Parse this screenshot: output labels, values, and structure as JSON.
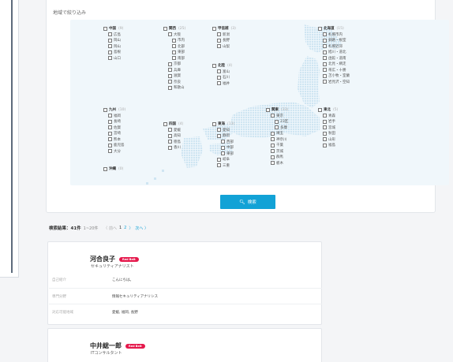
{
  "filter": {
    "title": "地域で絞り込み",
    "regions": [
      {
        "name": "中国",
        "count": "(9)",
        "prefs": [
          "広島",
          "岡山",
          "岡山",
          "島根",
          "山口"
        ]
      },
      {
        "name": "関西",
        "count": "(25)",
        "prefs": [
          "大阪",
          "市内",
          "北部",
          "東部",
          "南部",
          "京都",
          "兵庫",
          "滋賀",
          "奈良",
          "和歌山"
        ]
      },
      {
        "name": "甲信越",
        "count": "(3)",
        "prefs": [
          "新潟",
          "長野",
          "山梨"
        ]
      },
      {
        "name": "北陸",
        "count": "(4)",
        "prefs": [
          "富山",
          "石川",
          "福井"
        ]
      },
      {
        "name": "北海道",
        "count": "(15)",
        "prefs": [
          "札幌市内",
          "釧路・根室",
          "札幌近郊",
          "旭川・道北",
          "函館・道南",
          "北見・網走",
          "帯広・十勝",
          "苫小牧・室蘭",
          "岩見沢・空知"
        ]
      },
      {
        "name": "九州",
        "count": "(10)",
        "prefs": [
          "福岡",
          "長崎",
          "佐賀",
          "宮崎",
          "熊本",
          "鹿児島",
          "大分"
        ]
      },
      {
        "name": "四国",
        "count": "(4)",
        "prefs": [
          "愛媛",
          "高知",
          "徳島",
          "香川"
        ]
      },
      {
        "name": "東海",
        "count": "(13)",
        "prefs": [
          "愛知",
          "静岡",
          "西部",
          "中部",
          "東部",
          "岐阜",
          "三重"
        ]
      },
      {
        "name": "関東",
        "count": "(33)",
        "prefs": [
          "東京",
          "23区",
          "多摩",
          "埼玉",
          "神奈川",
          "千葉",
          "茨城",
          "群馬",
          "栃木"
        ]
      },
      {
        "name": "東北",
        "count": "(5)",
        "prefs": [
          "青森",
          "岩手",
          "宮城",
          "秋田",
          "山形",
          "福島"
        ]
      },
      {
        "name": "沖縄",
        "count": "(0)",
        "prefs": []
      }
    ],
    "search_label": "検索",
    "search_icon": "magnifier-icon"
  },
  "results": {
    "label": "検索結果：41件",
    "range": "1~20件",
    "prev": "〈 前へ",
    "pages": [
      "1",
      "2"
    ],
    "next_sep": "〉",
    "next": "次へ 〉"
  },
  "cards": [
    {
      "name": "河合良子",
      "badge": "Red Belt",
      "title": "セキュリティアナリスト",
      "rows": [
        {
          "key": "自己紹介",
          "value": "こんにちは。"
        },
        {
          "key": "専門分野",
          "value": "情報セキュリティアナリシス"
        },
        {
          "key": "対応可能地域",
          "value": "愛媛, 福岡, 長野"
        }
      ]
    },
    {
      "name": "中井総一郎",
      "badge": "Red Belt",
      "title": "ITコンサルタント",
      "rows": []
    }
  ],
  "colors": {
    "accent": "#12a2d6",
    "badge": "#e5194c",
    "map": "#cfe5f2"
  }
}
